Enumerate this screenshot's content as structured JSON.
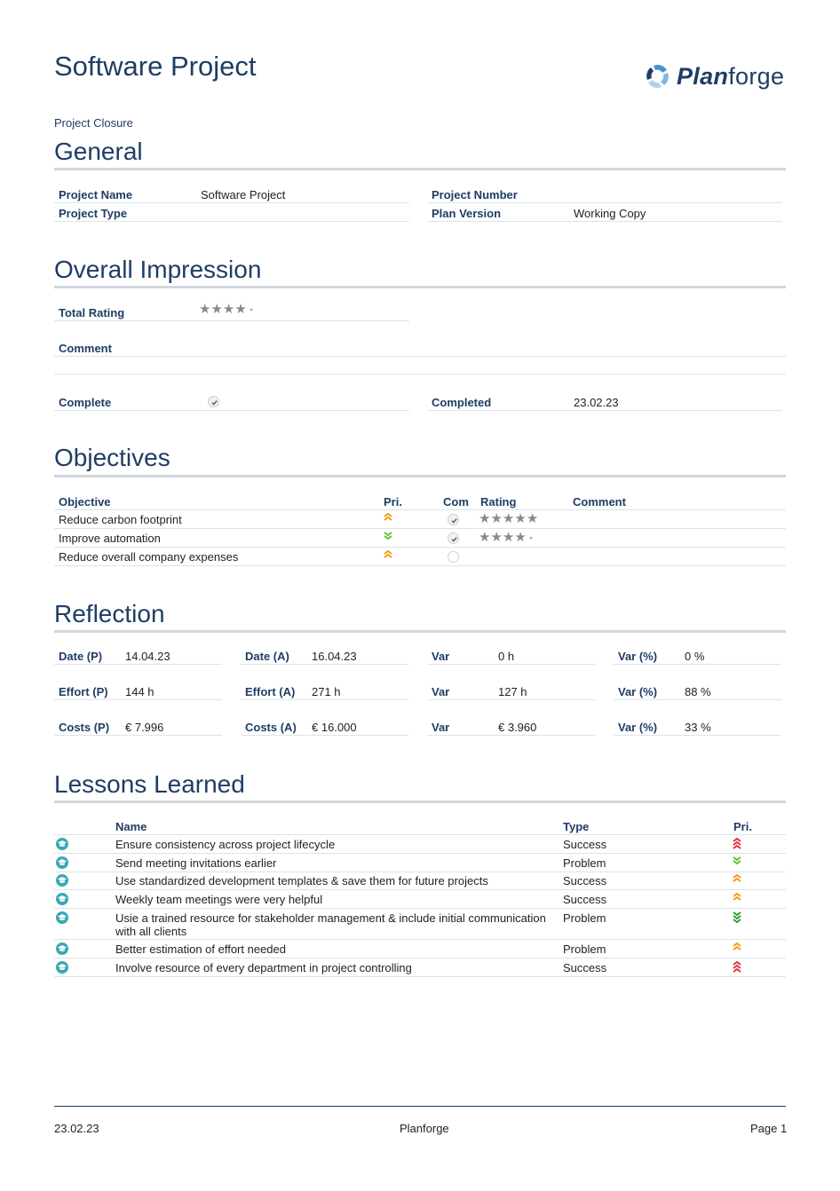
{
  "header": {
    "title": "Software Project",
    "logo_bold": "Plan",
    "logo_light": "forge",
    "subtitle": "Project Closure"
  },
  "general": {
    "title": "General",
    "fields": [
      {
        "label": "Project Name",
        "value": "Software Project"
      },
      {
        "label": "Project Number",
        "value": ""
      },
      {
        "label": "Project Type",
        "value": ""
      },
      {
        "label": "Plan Version",
        "value": "Working Copy"
      }
    ]
  },
  "impression": {
    "title": "Overall Impression",
    "total_rating_label": "Total Rating",
    "total_rating": 4,
    "rating_max": 5,
    "comment_label": "Comment",
    "comment_value": "",
    "complete_label": "Complete",
    "complete": true,
    "completed_label": "Completed",
    "completed_value": "23.02.23"
  },
  "objectives": {
    "title": "Objectives",
    "columns": [
      "Objective",
      "Pri.",
      "Com",
      "Rating",
      "Comment"
    ],
    "rows": [
      {
        "objective": "Reduce carbon footprint",
        "priority": "high",
        "complete": true,
        "rating": 5,
        "comment": ""
      },
      {
        "objective": "Improve automation",
        "priority": "low",
        "complete": true,
        "rating": 4,
        "comment": ""
      },
      {
        "objective": "Reduce overall company expenses",
        "priority": "high",
        "complete": false,
        "rating": 0,
        "comment": ""
      }
    ]
  },
  "reflection": {
    "title": "Reflection",
    "rows": [
      [
        {
          "label": "Date (P)",
          "value": "14.04.23"
        },
        {
          "label": "Date (A)",
          "value": "16.04.23"
        },
        {
          "label": "Var",
          "value": "0 h"
        },
        {
          "label": "Var (%)",
          "value": "0 %"
        }
      ],
      [
        {
          "label": "Effort (P)",
          "value": "144 h"
        },
        {
          "label": "Effort (A)",
          "value": "271 h"
        },
        {
          "label": "Var",
          "value": "127 h"
        },
        {
          "label": "Var (%)",
          "value": "88 %"
        }
      ],
      [
        {
          "label": "Costs (P)",
          "value": "€ 7.996"
        },
        {
          "label": "Costs (A)",
          "value": "€ 16.000"
        },
        {
          "label": "Var",
          "value": "€ 3.960"
        },
        {
          "label": "Var (%)",
          "value": "33 %"
        }
      ]
    ]
  },
  "lessons": {
    "title": "Lessons Learned",
    "columns": [
      "Name",
      "Type",
      "Pri."
    ],
    "rows": [
      {
        "name": "Ensure consistency across project lifecycle",
        "type": "Success",
        "priority": "very-high"
      },
      {
        "name": "Send meeting invitations earlier",
        "type": "Problem",
        "priority": "low"
      },
      {
        "name": "Use standardized development templates & save them for future projects",
        "type": "Success",
        "priority": "high"
      },
      {
        "name": "Weekly team meetings were very helpful",
        "type": "Success",
        "priority": "high"
      },
      {
        "name": "Usie a trained resource for stakeholder management & include initial communication with all clients",
        "type": "Problem",
        "priority": "very-low"
      },
      {
        "name": "Better estimation of effort needed",
        "type": "Problem",
        "priority": "high"
      },
      {
        "name": "Involve resource of every department in project controlling",
        "type": "Success",
        "priority": "very-high"
      }
    ]
  },
  "colors": {
    "heading": "#1f3d64",
    "priority_high": "#f39c12",
    "priority_very_high": "#e0323e",
    "priority_low": "#62c132",
    "priority_very_low": "#2e9a35",
    "lesson_icon": "#39a9b5"
  },
  "footer": {
    "date": "23.02.23",
    "center": "Planforge",
    "page": "Page 1"
  }
}
